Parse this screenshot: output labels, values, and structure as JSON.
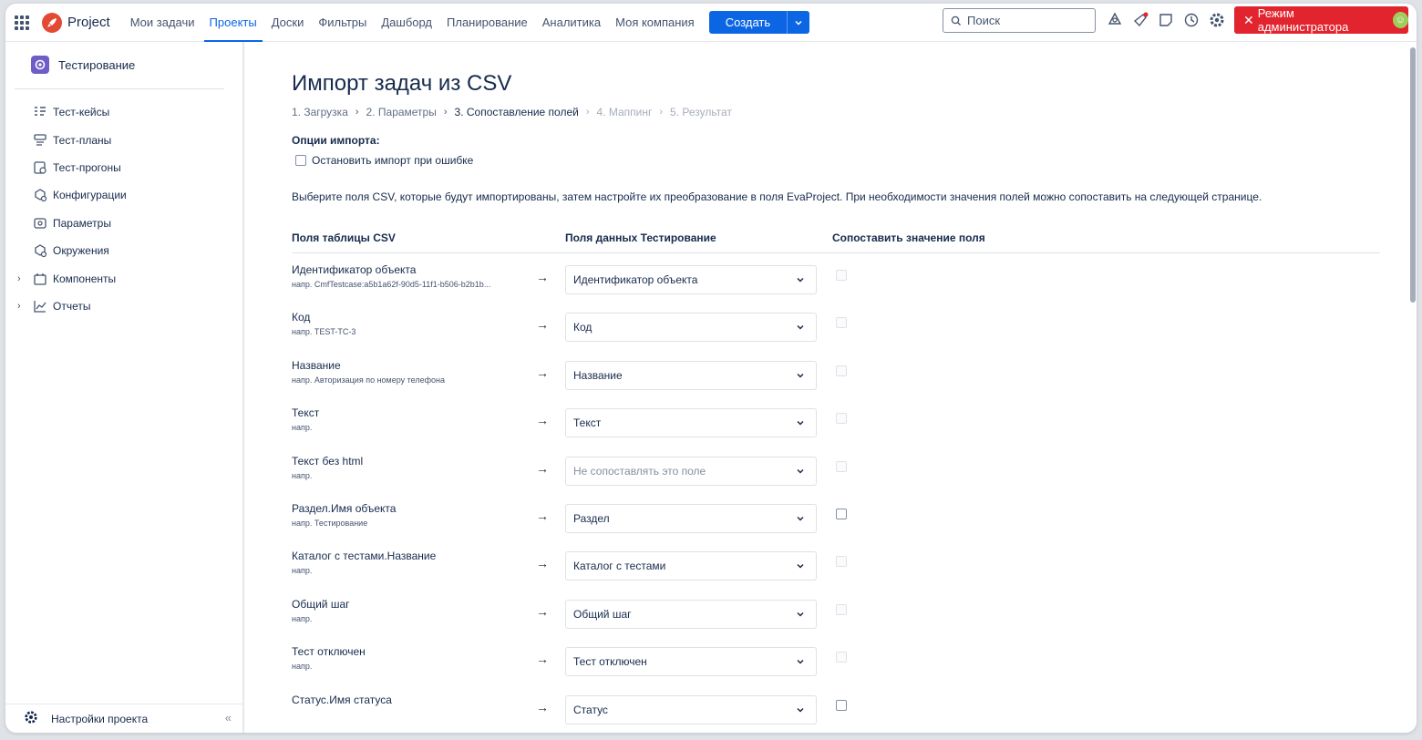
{
  "topbar": {
    "logo_text": "Project",
    "nav": [
      "Мои задачи",
      "Проекты",
      "Доски",
      "Фильтры",
      "Дашборд",
      "Планирование",
      "Аналитика",
      "Моя компания"
    ],
    "active_nav": "Проекты",
    "create_label": "Создать",
    "search_placeholder": "Поиск",
    "admin_label": "Режим администратора",
    "accent": "#0c66e4",
    "admin_color": "#e2242e"
  },
  "sidebar": {
    "project_name": "Тестирование",
    "items": [
      {
        "label": "Тест-кейсы",
        "icon": "test-cases-icon",
        "expandable": false
      },
      {
        "label": "Тест-планы",
        "icon": "test-plans-icon",
        "expandable": false
      },
      {
        "label": "Тест-прогоны",
        "icon": "test-runs-icon",
        "expandable": false
      },
      {
        "label": "Конфигурации",
        "icon": "configurations-icon",
        "expandable": false
      },
      {
        "label": "Параметры",
        "icon": "parameters-icon",
        "expandable": false
      },
      {
        "label": "Окружения",
        "icon": "environments-icon",
        "expandable": false
      },
      {
        "label": "Компоненты",
        "icon": "components-icon",
        "expandable": true
      },
      {
        "label": "Отчеты",
        "icon": "reports-icon",
        "expandable": true
      }
    ],
    "footer_label": "Настройки проекта"
  },
  "main": {
    "title": "Импорт задач из CSV",
    "steps": [
      {
        "label": "1. Загрузка",
        "state": "done"
      },
      {
        "label": "2. Параметры",
        "state": "done"
      },
      {
        "label": "3. Сопоставление полей",
        "state": "current"
      },
      {
        "label": "4. Маппинг",
        "state": "future"
      },
      {
        "label": "5. Результат",
        "state": "future"
      }
    ],
    "options_title": "Опции импорта:",
    "stop_on_error_label": "Остановить импорт при ошибке",
    "description": "Выберите поля CSV, которые будут импортированы, затем настройте их преобразование в поля EvaProject. При необходимости значения полей можно сопоставить на следующей странице.",
    "columns": [
      "Поля таблицы CSV",
      "Поля данных Тестирование",
      "Сопоставить значение поля"
    ],
    "rows": [
      {
        "field": "Идентификатор объекта",
        "example": "напр. CmfTestcase:a5b1a62f-90d5-11f1-b506-b2b1b...",
        "target": "Идентификатор объекта",
        "placeholder": false,
        "map_enabled": false
      },
      {
        "field": "Код",
        "example": "напр. TEST-TC-3",
        "target": "Код",
        "placeholder": false,
        "map_enabled": false
      },
      {
        "field": "Название",
        "example": "напр. Авторизация по номеру телефона",
        "target": "Название",
        "placeholder": false,
        "map_enabled": false
      },
      {
        "field": "Текст",
        "example": "напр.",
        "target": "Текст",
        "placeholder": false,
        "map_enabled": false
      },
      {
        "field": "Текст без html",
        "example": "напр.",
        "target": "Не сопоставлять это поле",
        "placeholder": true,
        "map_enabled": false
      },
      {
        "field": "Раздел.Имя объекта",
        "example": "напр. Тестирование",
        "target": "Раздел",
        "placeholder": false,
        "map_enabled": true
      },
      {
        "field": "Каталог с тестами.Название",
        "example": "напр.",
        "target": "Каталог с тестами",
        "placeholder": false,
        "map_enabled": false
      },
      {
        "field": "Общий шаг",
        "example": "напр.",
        "target": "Общий шаг",
        "placeholder": false,
        "map_enabled": false
      },
      {
        "field": "Тест отключен",
        "example": "напр.",
        "target": "Тест отключен",
        "placeholder": false,
        "map_enabled": false
      },
      {
        "field": "Статус.Имя статуса",
        "example": "",
        "target": "Статус",
        "placeholder": false,
        "map_enabled": true
      }
    ]
  }
}
